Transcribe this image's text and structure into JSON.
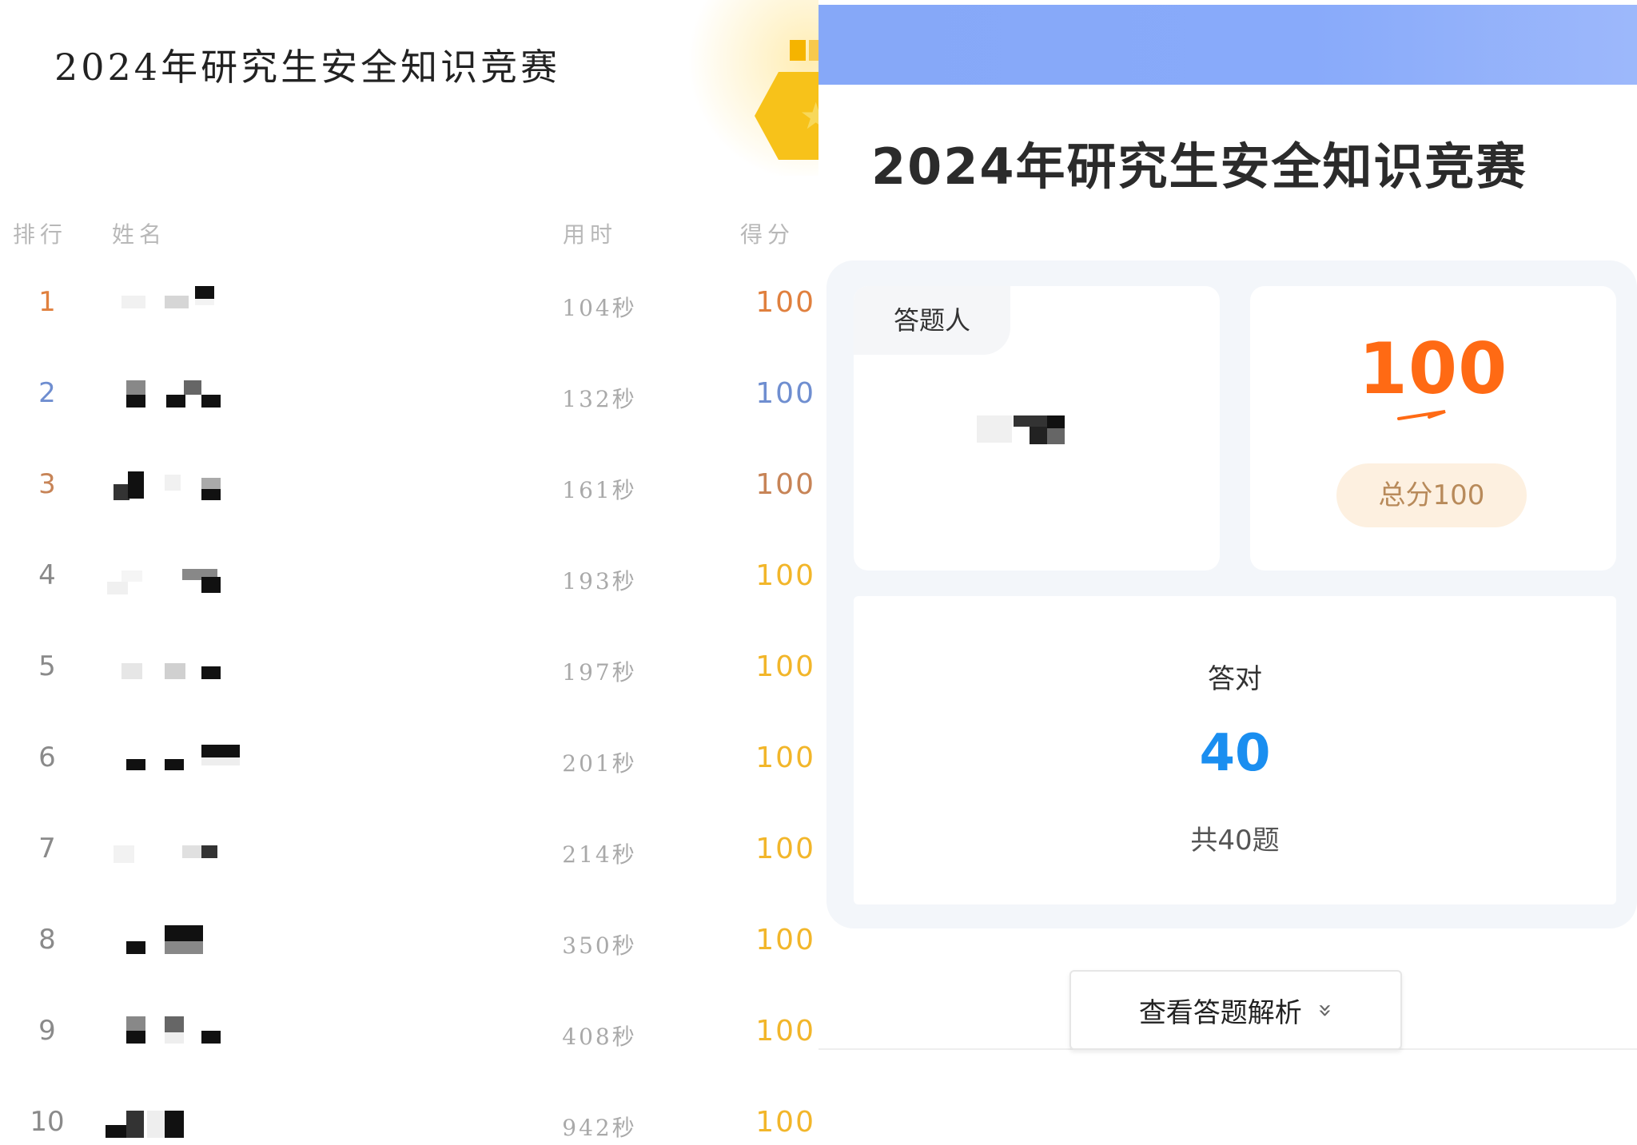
{
  "leaderboard": {
    "title": "2024年研究生安全知识竞赛",
    "headers": {
      "rank": "排行",
      "name": "姓名",
      "time": "用时",
      "score": "得分"
    },
    "rows": [
      {
        "rank": "1",
        "time": "104秒",
        "score": "100",
        "rank_color": "#e0803e",
        "score_color": "#e0803e"
      },
      {
        "rank": "2",
        "time": "132秒",
        "score": "100",
        "rank_color": "#6f8ed0",
        "score_color": "#6f8ed0"
      },
      {
        "rank": "3",
        "time": "161秒",
        "score": "100",
        "rank_color": "#c78457",
        "score_color": "#c78457"
      },
      {
        "rank": "4",
        "time": "193秒",
        "score": "100",
        "rank_color": "#8a8a8a",
        "score_color": "#f2b62a"
      },
      {
        "rank": "5",
        "time": "197秒",
        "score": "100",
        "rank_color": "#8a8a8a",
        "score_color": "#f2b62a"
      },
      {
        "rank": "6",
        "time": "201秒",
        "score": "100",
        "rank_color": "#8a8a8a",
        "score_color": "#f2b62a"
      },
      {
        "rank": "7",
        "time": "214秒",
        "score": "100",
        "rank_color": "#8a8a8a",
        "score_color": "#f2b62a"
      },
      {
        "rank": "8",
        "time": "350秒",
        "score": "100",
        "rank_color": "#8a8a8a",
        "score_color": "#f2b62a"
      },
      {
        "rank": "9",
        "time": "408秒",
        "score": "100",
        "rank_color": "#8a8a8a",
        "score_color": "#f2b62a"
      },
      {
        "rank": "10",
        "time": "942秒",
        "score": "100",
        "rank_color": "#8a8a8a",
        "score_color": "#f2b62a"
      }
    ]
  },
  "result": {
    "title": "2024年研究生安全知识竞赛",
    "participant_label": "答题人",
    "score": "100",
    "total_score": "总分100",
    "correct_label": "答对",
    "correct_count": "40",
    "question_total": "共40题",
    "analysis_button": "查看答题解析",
    "accent_color": "#ff6a14",
    "correct_color": "#1a8ef0",
    "banner_color": "#88aafa"
  }
}
